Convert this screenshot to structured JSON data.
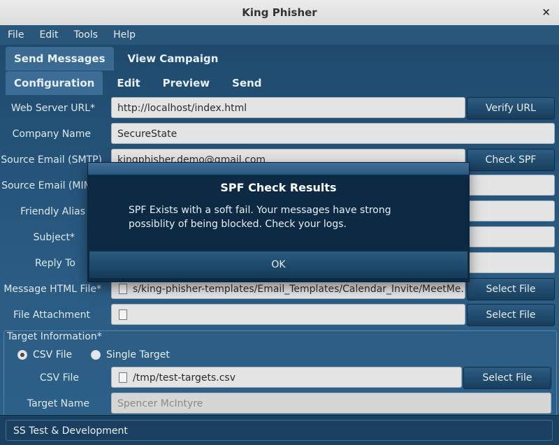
{
  "window": {
    "title": "King Phisher",
    "close_glyph": "×"
  },
  "menu": [
    "File",
    "Edit",
    "Tools",
    "Help"
  ],
  "main_tabs": [
    "Send Messages",
    "View Campaign"
  ],
  "sub_tabs": [
    "Configuration",
    "Edit",
    "Preview",
    "Send"
  ],
  "form": {
    "web_server_url": {
      "label": "Web Server URL*",
      "value": "http://localhost/index.html",
      "button": "Verify URL"
    },
    "company_name": {
      "label": "Company Name",
      "value": "SecureState"
    },
    "source_email_smtp": {
      "label": "Source Email (SMTP)",
      "value": "kingphisher.demo@gmail.com",
      "button": "Check SPF"
    },
    "source_email_mime": {
      "label": "Source Email (MIME)"
    },
    "friendly_alias": {
      "label": "Friendly Alias"
    },
    "subject": {
      "label": "Subject*"
    },
    "reply_to": {
      "label": "Reply To"
    },
    "message_html_file": {
      "label": "Message HTML File*",
      "value": "s/king-phisher-templates/Email_Templates/Calendar_Invite/MeetMe.html",
      "button": "Select File"
    },
    "file_attachment": {
      "label": "File Attachment",
      "value": "",
      "button": "Select File"
    }
  },
  "target_info": {
    "title": "Target Information*",
    "options": [
      "CSV File",
      "Single Target"
    ],
    "selected": "CSV File",
    "csv_file": {
      "label": "CSV File",
      "value": "/tmp/test-targets.csv",
      "button": "Select File"
    },
    "target_name": {
      "label": "Target Name",
      "placeholder": "Spencer McIntyre"
    }
  },
  "status": {
    "text": "SS Test & Development"
  },
  "dialog": {
    "title": "SPF Check Results",
    "message": "SPF Exists with a soft fail. Your messages have strong possiblity of being blocked. Check your logs.",
    "ok": "OK"
  },
  "colors": {
    "accent": "#2a5679",
    "dialog_bg": "#0c2a44",
    "titlebar": "#e4e4e4"
  }
}
